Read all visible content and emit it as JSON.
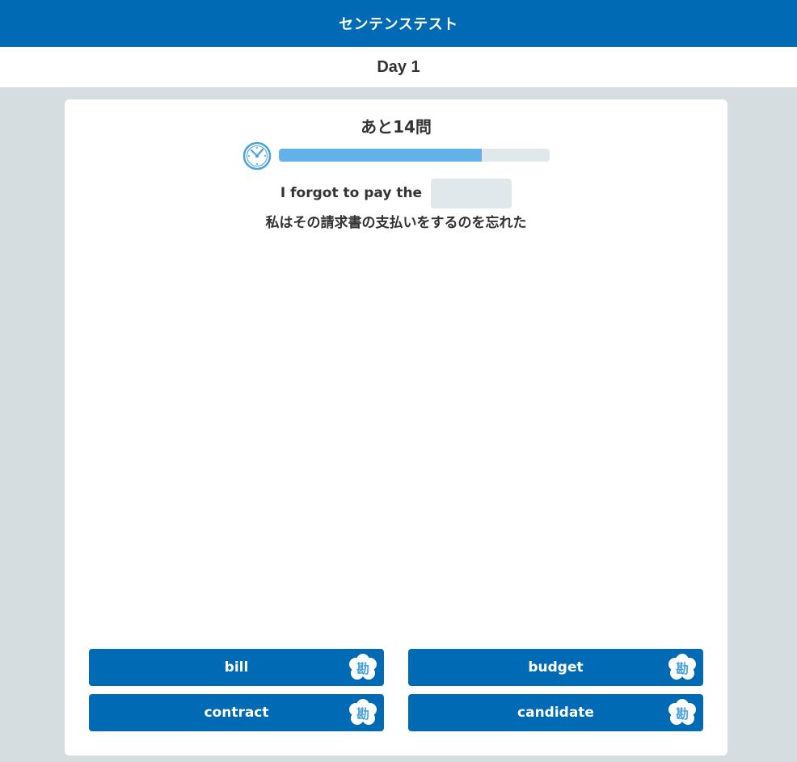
{
  "header": {
    "title": "センテンステスト"
  },
  "day": {
    "label": "Day 1"
  },
  "quiz": {
    "remaining_label": "あと14問",
    "timer_progress": 0.75,
    "sentence_prefix": "I forgot to pay the",
    "translation": "私はその請求書の支払いをするのを忘れた"
  },
  "choices": [
    {
      "label": "bill",
      "hint_char": "勘"
    },
    {
      "label": "budget",
      "hint_char": "勘"
    },
    {
      "label": "contract",
      "hint_char": "勘"
    },
    {
      "label": "candidate",
      "hint_char": "勘"
    }
  ],
  "colors": {
    "primary": "#006ab4",
    "progress_fill": "#62b1e9",
    "progress_track": "#e1e8ec",
    "background": "#d5dde1"
  },
  "icons": {
    "timer": "clock-icon",
    "hint": "hint-flower-icon"
  }
}
